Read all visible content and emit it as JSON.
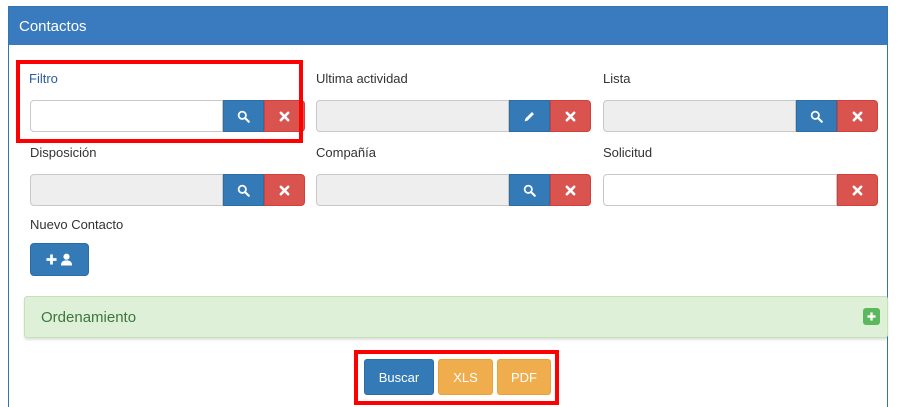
{
  "panel": {
    "title": "Contactos"
  },
  "filters": {
    "filtro": {
      "label": "Filtro",
      "value": ""
    },
    "ultima_actividad": {
      "label": "Ultima actividad",
      "value": ""
    },
    "lista": {
      "label": "Lista",
      "value": ""
    },
    "disposicion": {
      "label": "Disposición",
      "value": ""
    },
    "compania": {
      "label": "Compañía",
      "value": ""
    },
    "solicitud": {
      "label": "Solicitud",
      "value": ""
    }
  },
  "nuevo_contacto": {
    "label": "Nuevo Contacto"
  },
  "ordenamiento": {
    "title": "Ordenamiento"
  },
  "actions": {
    "buscar": "Buscar",
    "xls": "XLS",
    "pdf": "PDF"
  },
  "colors": {
    "header": "#3a7bbf",
    "primary": "#337ab7",
    "danger": "#d9534f",
    "warning": "#f0ad4e",
    "success_bg": "#dff0d8",
    "highlight": "#ff0000"
  }
}
